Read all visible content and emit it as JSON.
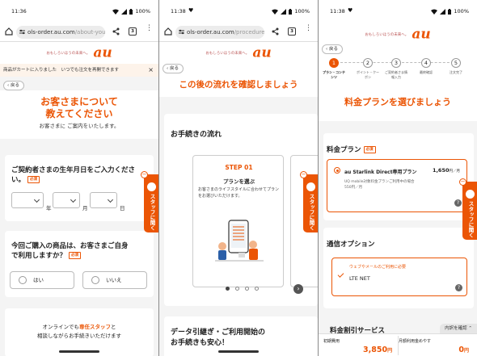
{
  "status_bar": {
    "left": {
      "time": "11:36",
      "battery": "100%"
    },
    "middle": {
      "time": "11:38",
      "battery": "100%"
    },
    "right": {
      "time": "11:38",
      "battery": "100%"
    }
  },
  "browser": {
    "left": {
      "url_main": "ols-order.au.com",
      "url_path": "/about-you",
      "tab_count": "3"
    },
    "middle": {
      "url_main": "ols-order.au.com",
      "url_path": "/procedure",
      "tab_count": "3"
    }
  },
  "brand": {
    "tagline": "おもしろいほうの未来へ。",
    "logo": "au"
  },
  "colors": {
    "accent": "#eb5505",
    "background": "#f4f4f4"
  },
  "left_panel": {
    "cart_notice": "商品がカートに入りました　いつでも注文を再開できます",
    "back_label": "戻る",
    "heading_line1": "お客さまについて",
    "heading_line2": "教えてください",
    "subheading": "お客さまに ご案内をいたします。",
    "birthday": {
      "question_line1": "ご契約者さまの生年月日をご入力くださ",
      "question_line2": "い。",
      "required": "必須",
      "year_unit": "年",
      "month_unit": "月",
      "day_unit": "日"
    },
    "self_use": {
      "question_line1": "今回ご購入の商品は、お客さまご自身",
      "question_line2": "で利用しますか？",
      "required": "必須",
      "yes": "はい",
      "no": "いいえ"
    },
    "online": {
      "line1_pre": "オンラインでも",
      "line1_highlight": "専任スタッフ",
      "line1_post": "と",
      "line2": "相談しながらお手続きいただけます"
    }
  },
  "middle_panel": {
    "back_label": "戻る",
    "heading": "この後の流れを確認しましょう",
    "section_title": "お手続きの流れ",
    "step": {
      "label": "STEP 01",
      "title": "プランを選ぶ",
      "description": "お客さまのライフスタイルに合わせてプランをお選びいただけます。"
    },
    "carousel": {
      "total_dots": 4,
      "active_dot": 1
    },
    "bottom_line1": "データ引継ぎ・ご利用開始の",
    "bottom_line2": "お手続きも安心！"
  },
  "right_panel": {
    "back_label": "戻る",
    "steps": [
      {
        "number": "1",
        "label_line1": "プラン・コンテ",
        "label_line2": "ンツ",
        "active": true
      },
      {
        "number": "2",
        "label_line1": "ポイント・クー",
        "label_line2": "ポン",
        "active": false
      },
      {
        "number": "3",
        "label_line1": "ご契約者さま情",
        "label_line2": "報入力",
        "active": false
      },
      {
        "number": "4",
        "label_line1": "最終確認",
        "label_line2": "",
        "active": false
      },
      {
        "number": "5",
        "label_line1": "注文完了",
        "label_line2": "",
        "active": false
      }
    ],
    "heading": "料金プランを選びましょう",
    "plan_section": {
      "title": "料金プラン",
      "required": "必須",
      "plan_name": "au Starlink Direct専用プラン",
      "price": "1,650",
      "price_unit": "円／月",
      "note_line1": "UQ mobile対象料金プランご利用中の場合",
      "note_line2": "550円／月"
    },
    "option_section": {
      "title": "通信オプション",
      "option_title": "ウェブやメールのご利用に必要",
      "option_name": "LTE NET"
    },
    "discount_title": "料金割引サービス",
    "details_button": "内訳を確認",
    "footer": {
      "initial_label": "初期費用",
      "initial_value": "3,850",
      "initial_unit": "円",
      "monthly_label": "月額利用金めやす",
      "monthly_value": "0",
      "monthly_unit": "円"
    }
  },
  "staff_tab": {
    "label": "スタッフに聞く"
  }
}
